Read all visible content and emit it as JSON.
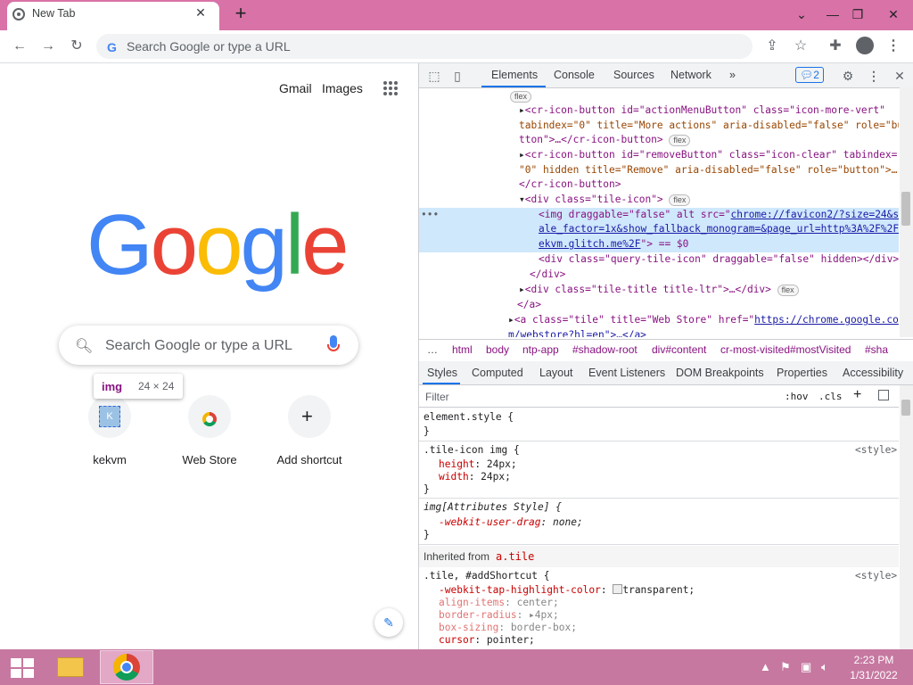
{
  "browser": {
    "tab_title": "New Tab",
    "tab_close": "✕",
    "new_tab": "+",
    "window_controls": {
      "minimize": "—",
      "restore": "❐",
      "close": "✕",
      "tab_search": "⌄"
    },
    "omnibox_placeholder": "Search Google or type a URL",
    "omnibox_g": "G"
  },
  "ntp": {
    "gmail": "Gmail",
    "images": "Images",
    "logo": [
      "G",
      "o",
      "o",
      "g",
      "l",
      "e"
    ],
    "logo_colors": [
      "#4285f4",
      "#ea4335",
      "#fbbc05",
      "#4285f4",
      "#34a853",
      "#ea4335"
    ],
    "search_placeholder": "Search Google or type a URL",
    "tooltip": {
      "tag": "img",
      "size": "24 × 24"
    },
    "shortcuts": [
      {
        "label": "kekvm",
        "monogram": "K"
      },
      {
        "label": "Web Store"
      },
      {
        "label": "Add shortcut"
      }
    ],
    "edit_icon": "✎"
  },
  "devtools": {
    "tabs": [
      "Elements",
      "Console",
      "Sources",
      "Network",
      "»"
    ],
    "issues_count": "2",
    "dom": {
      "l0_badge": "flex",
      "l1": "<cr-icon-button id=\"actionMenuButton\" class=\"icon-more-vert\"",
      "l2": "tabindex=\"0\" title=\"More actions\" aria-disabled=\"false\" role=\"bu",
      "l3": "tton\">…</cr-icon-button>",
      "l4": "<cr-icon-button id=\"removeButton\" class=\"icon-clear\" tabindex=",
      "l5": "\"0\" hidden title=\"Remove\" aria-disabled=\"false\" role=\"button\">…",
      "l6": "</cr-icon-button>",
      "l7": "<div class=\"tile-icon\">",
      "l8a": "<img draggable=\"false\" alt src=\"",
      "l8b": "chrome://favicon2/?size=24&sc",
      "l9": "ale_factor=1x&show_fallback_monogram=&page_url=http%3A%2F%2Fk",
      "l10a": "ekvm.glitch.me%2F",
      "l10b": "\"> == $0",
      "l11": "<div class=\"query-tile-icon\" draggable=\"false\" hidden></div>",
      "l12": "</div>",
      "l13": "<div class=\"tile-title title-ltr\">…</div>",
      "l14": "</a>",
      "l15a": "<a class=\"tile\" title=\"Web Store\" href=\"",
      "l15b": "https://chrome.google.co",
      "l16": "m/webstore?hl=en\">…</a>",
      "badge": "flex",
      "ellipsis": "•••"
    },
    "breadcrumbs": [
      "…",
      "html",
      "body",
      "ntp-app",
      "#shadow-root",
      "div#content",
      "cr-most-visited#mostVisited",
      "#sha"
    ],
    "style_tabs": [
      "Styles",
      "Computed",
      "Layout",
      "Event Listeners",
      "DOM Breakpoints",
      "Properties",
      "Accessibility"
    ],
    "filter_placeholder": "Filter",
    "hov": ":hov",
    "cls": ".cls",
    "rules": {
      "element_style": "element.style {",
      "close": "}",
      "r1_selector": ".tile-icon img {",
      "r1_source": "<style>",
      "r1_p1_name": "height",
      "r1_p1_val": "24px;",
      "r1_p2_name": "width",
      "r1_p2_val": "24px;",
      "r2_selector": "img[Attributes Style] {",
      "r2_p1_name": "-webkit-user-drag",
      "r2_p1_val": "none;",
      "inherited_label": "Inherited from",
      "inherited_from": "a.tile",
      "r3_selector": ".tile, #addShortcut {",
      "r3_source": "<style>",
      "r3_p1_name": "-webkit-tap-highlight-color",
      "r3_p1_val": "transparent;",
      "r3_p2_name": "align-items",
      "r3_p2_val": "center;",
      "r3_p3_name": "border-radius",
      "r3_p3_val": "4px;",
      "r3_p4_name": "box-sizing",
      "r3_p4_val": "border-box;",
      "r3_p5_name": "cursor",
      "r3_p5_val": "pointer;"
    }
  },
  "taskbar": {
    "time": "2:23 PM",
    "date": "1/31/2022",
    "tray_icons": [
      "chevron-up-icon",
      "flag-icon",
      "network-icon",
      "volume-icon"
    ]
  },
  "colors": {
    "titlebar": "#d872a7",
    "taskbar": "#c678a0",
    "accent": "#1a73e8",
    "selected_node": "#cfe8fc"
  }
}
